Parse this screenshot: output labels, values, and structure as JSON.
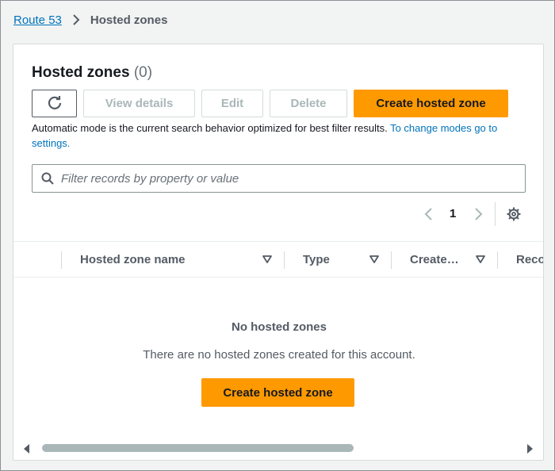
{
  "breadcrumb": {
    "root": "Route 53",
    "current": "Hosted zones"
  },
  "header": {
    "title": "Hosted zones",
    "count": "(0)"
  },
  "toolbar": {
    "view_details": "View details",
    "edit": "Edit",
    "delete": "Delete",
    "create": "Create hosted zone"
  },
  "hint": {
    "text": "Automatic mode is the current search behavior optimized for best filter results.",
    "link": "To change modes go to settings."
  },
  "search": {
    "placeholder": "Filter records by property or value",
    "value": ""
  },
  "pagination": {
    "page": "1"
  },
  "table": {
    "columns": [
      "Hosted zone name",
      "Type",
      "Create…",
      "Reco"
    ]
  },
  "empty": {
    "title": "No hosted zones",
    "description": "There are no hosted zones created for this account.",
    "button": "Create hosted zone"
  },
  "colors": {
    "accent": "#ff9900",
    "link": "#0073bb",
    "text_muted": "#545b64"
  },
  "icons": [
    "refresh-icon",
    "search-icon",
    "chevron-left-icon",
    "chevron-right-icon",
    "gear-icon",
    "sort-down-icon",
    "scroll-left-icon",
    "scroll-right-icon"
  ]
}
